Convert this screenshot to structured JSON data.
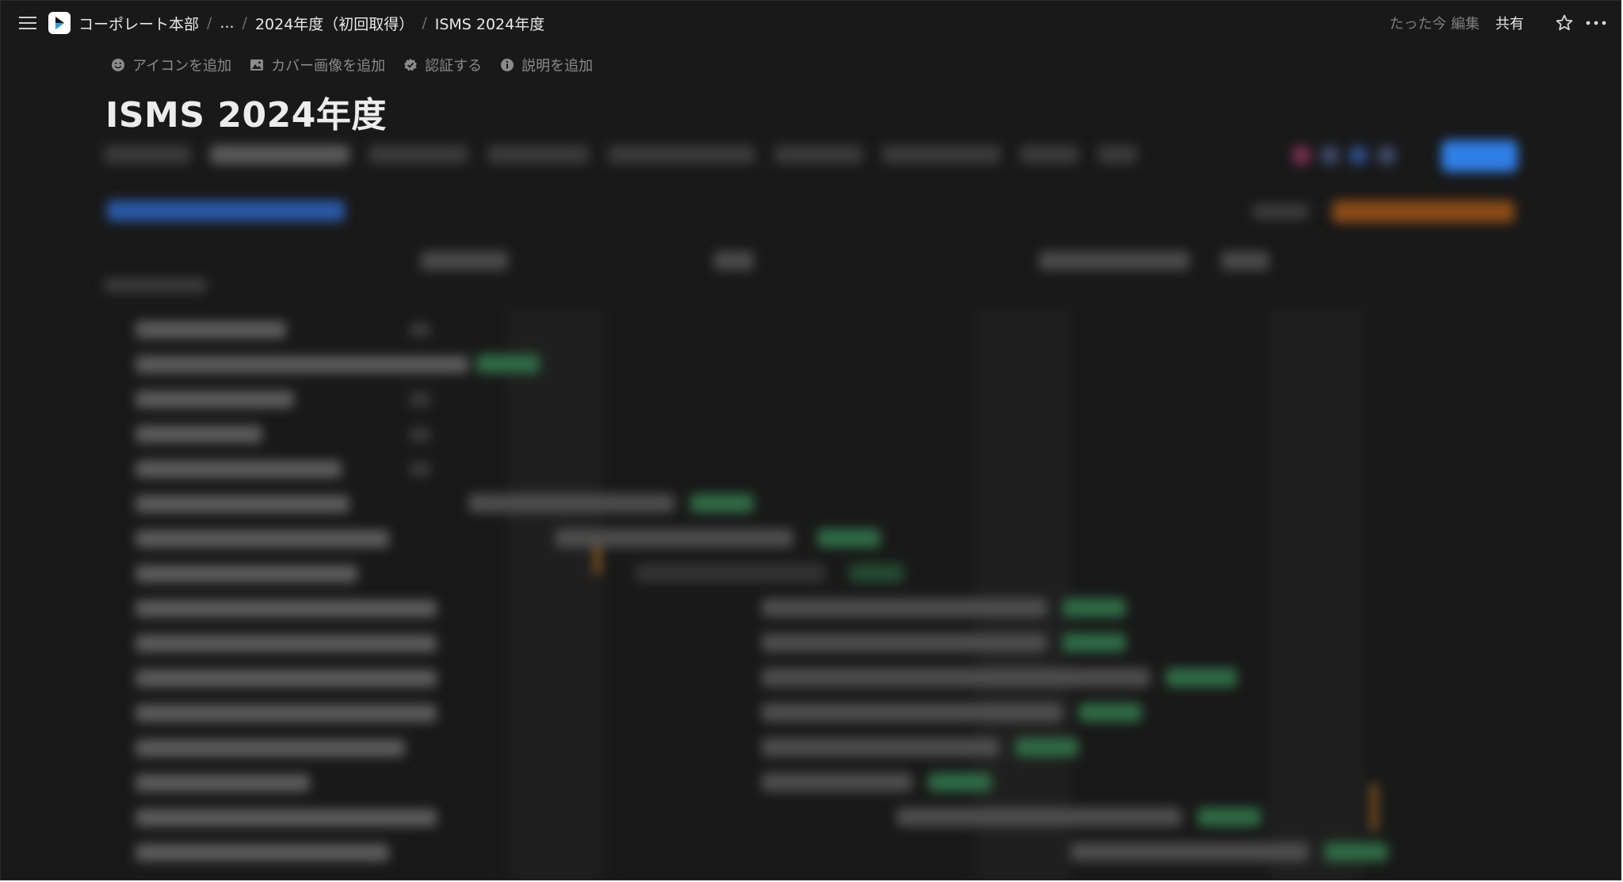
{
  "breadcrumb": {
    "items": [
      "コーポレート本部",
      "...",
      "2024年度（初回取得）",
      "ISMS 2024年度"
    ]
  },
  "topbar": {
    "edited_text": "たった今 編集",
    "share_label": "共有"
  },
  "page_actions": [
    {
      "label": "アイコンを追加",
      "icon": "smiley-icon"
    },
    {
      "label": "カバー画像を追加",
      "icon": "image-icon"
    },
    {
      "label": "認証する",
      "icon": "verified-badge-icon"
    },
    {
      "label": "説明を追加",
      "icon": "info-icon"
    }
  ],
  "page": {
    "title": "ISMS 2024年度"
  },
  "colors": {
    "background": "#191919",
    "accent_blue": "#2f7fe6",
    "status_green": "#2f6b45",
    "dependency_orange": "#b07020"
  }
}
